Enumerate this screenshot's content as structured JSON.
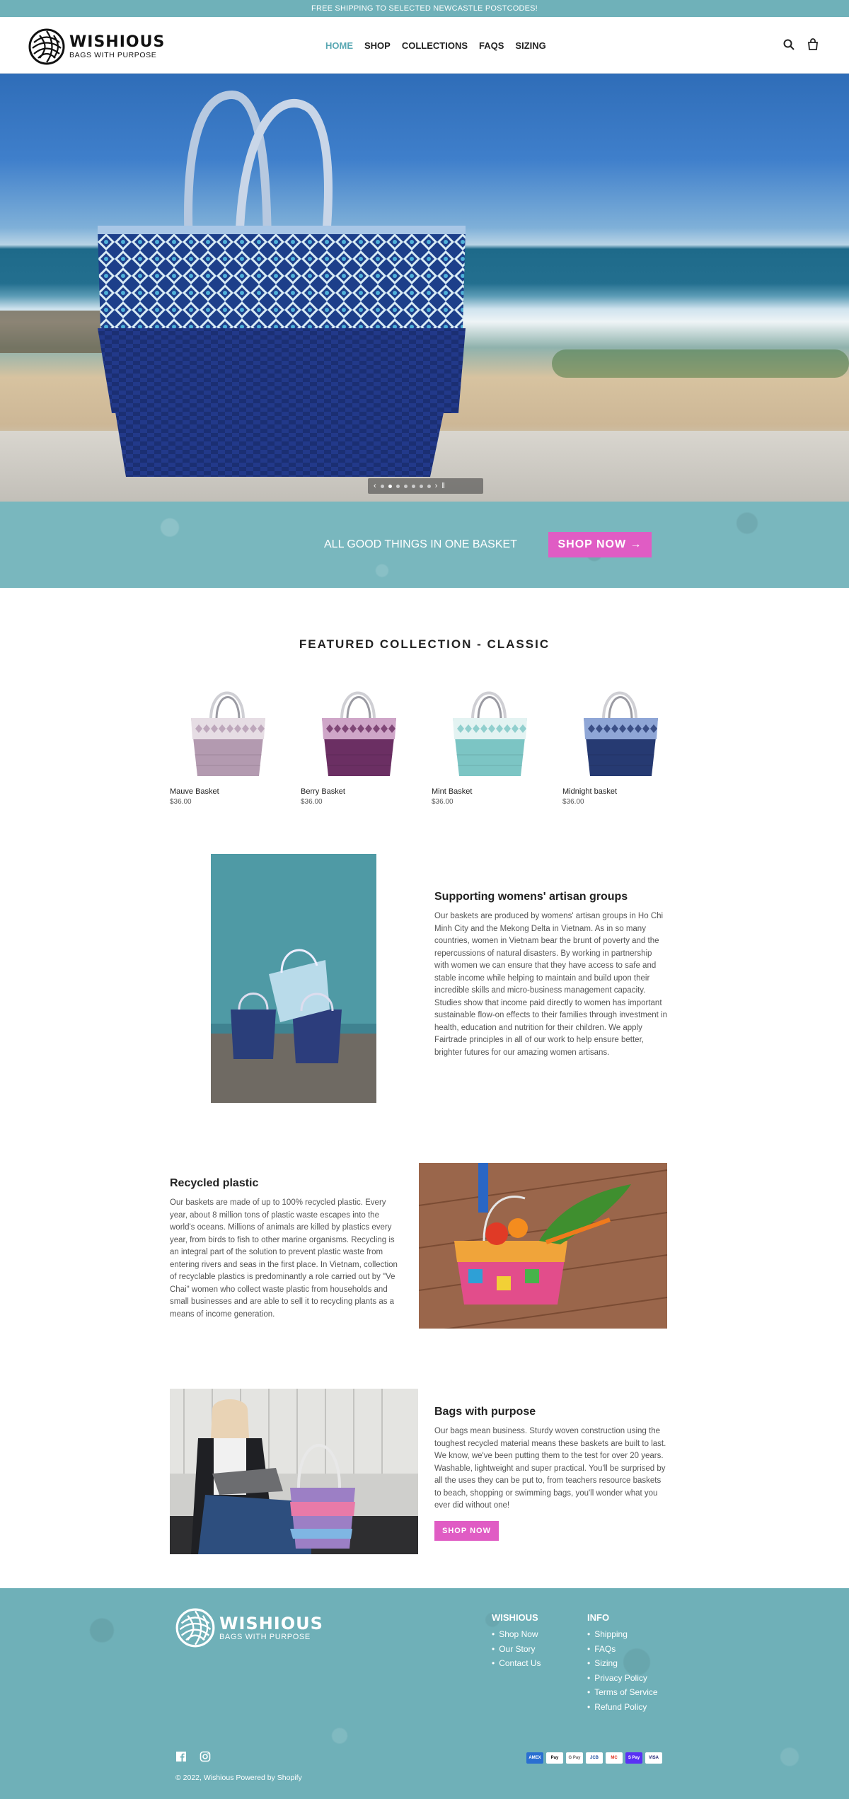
{
  "announcement": "FREE SHIPPING TO SELECTED NEWCASTLE POSTCODES!",
  "brand": {
    "name": "WISHIOUS",
    "tagline": "BAGS WITH PURPOSE"
  },
  "nav": [
    {
      "label": "HOME",
      "active": true
    },
    {
      "label": "SHOP",
      "active": false
    },
    {
      "label": "COLLECTIONS",
      "active": false
    },
    {
      "label": "FAQS",
      "active": false
    },
    {
      "label": "SIZING",
      "active": false
    }
  ],
  "header_icons": [
    "search-icon",
    "bag-icon"
  ],
  "hero": {
    "slide_count": 7,
    "current_slide": 2
  },
  "banner": {
    "text": "ALL GOOD THINGS IN ONE BASKET",
    "button": "SHOP NOW →"
  },
  "featured": {
    "title": "FEATURED COLLECTION - CLASSIC",
    "products": [
      {
        "name": "Mauve Basket",
        "price": "$36.00",
        "color": "#b39ab0",
        "pattern": "#e6dde4"
      },
      {
        "name": "Berry Basket",
        "price": "$36.00",
        "color": "#6b2f63",
        "pattern": "#cfa6c8"
      },
      {
        "name": "Mint Basket",
        "price": "$36.00",
        "color": "#7cc5c4",
        "pattern": "#e3f3f2"
      },
      {
        "name": "Midnight basket",
        "price": "$36.00",
        "color": "#263a72",
        "pattern": "#8fa6d6"
      }
    ]
  },
  "sections": [
    {
      "title": "Supporting womens' artisan groups",
      "body": "Our baskets are produced by womens' artisan groups in Ho Chi Minh City and the Mekong Delta in Vietnam. As in so many countries, women in Vietnam bear the brunt of poverty and the repercussions of natural disasters. By working in partnership with women we can ensure that they have access to safe and stable income while helping to maintain and build upon their incredible skills and micro-business management capacity. Studies show that income paid directly to women has important sustainable flow-on effects to their families through investment in health, education and nutrition for their children. We apply Fairtrade principles in all of our work to help ensure better, brighter futures for our amazing women artisans."
    },
    {
      "title": "Recycled plastic",
      "body": "Our baskets are made of up to 100% recycled plastic. Every year, about 8 million tons of plastic waste escapes into the world's oceans. Millions of animals are killed by plastics every year, from birds to fish to other marine organisms. Recycling is an integral part of the solution to prevent plastic waste from entering rivers and seas in the first place. In Vietnam, collection of recyclable plastics is predominantly a role carried out by \"Ve Chai\" women who collect waste plastic from households and small businesses and are able to sell it to recycling plants as a means of income generation."
    },
    {
      "title": "Bags with purpose",
      "body": "Our bags mean business. Sturdy woven construction using the toughest recycled material means these baskets are built to last. We know, we've been putting them to the test for over 20 years. Washable, lightweight and super practical. You'll be surprised by all the uses they can be put to, from teachers resource baskets to beach, shopping or swimming bags, you'll wonder what you ever did without one!",
      "button": "SHOP NOW"
    }
  ],
  "footer": {
    "col1": {
      "title": "WISHIOUS",
      "links": [
        "Shop Now",
        "Our Story",
        "Contact Us"
      ]
    },
    "col2": {
      "title": "INFO",
      "links": [
        "Shipping",
        "FAQs",
        "Sizing",
        "Privacy Policy",
        "Terms of Service",
        "Refund Policy"
      ]
    },
    "social": [
      "facebook-icon",
      "instagram-icon"
    ],
    "copyright": "© 2022, Wishious Powered by Shopify",
    "payments": [
      "AMEX",
      "Pay",
      "G Pay",
      "JCB",
      "MC",
      "S Pay",
      "VISA"
    ]
  }
}
